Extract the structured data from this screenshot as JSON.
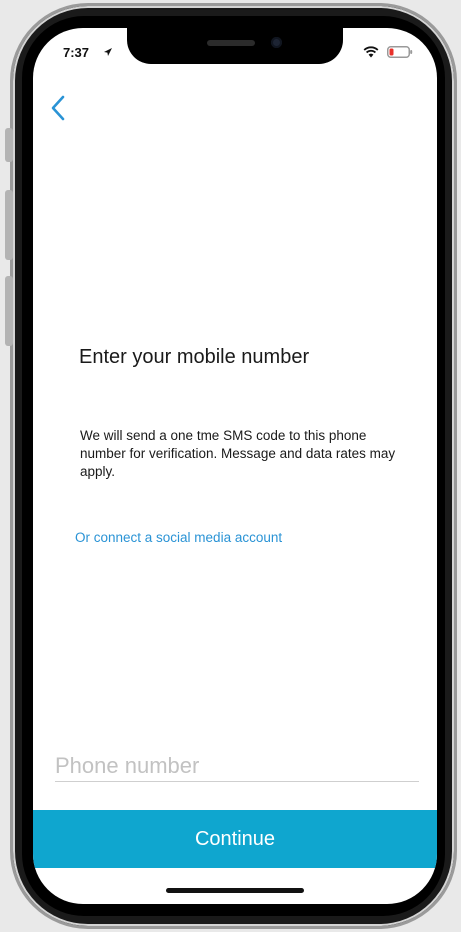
{
  "status_bar": {
    "time": "7:37"
  },
  "screen": {
    "title": "Enter your mobile number",
    "description": "We will send a one tme SMS code to this phone number for verification.  Message and data rates may apply.",
    "social_link": "Or connect a social media account",
    "phone_input": {
      "placeholder": "Phone number",
      "value": ""
    },
    "continue_label": "Continue"
  },
  "colors": {
    "accent": "#0fa6cf",
    "link": "#2a93d5",
    "back_chevron": "#2a93d5"
  },
  "icons": {
    "back": "chevron-left-icon",
    "location": "location-arrow-icon",
    "wifi": "wifi-icon",
    "battery": "battery-low-icon"
  }
}
